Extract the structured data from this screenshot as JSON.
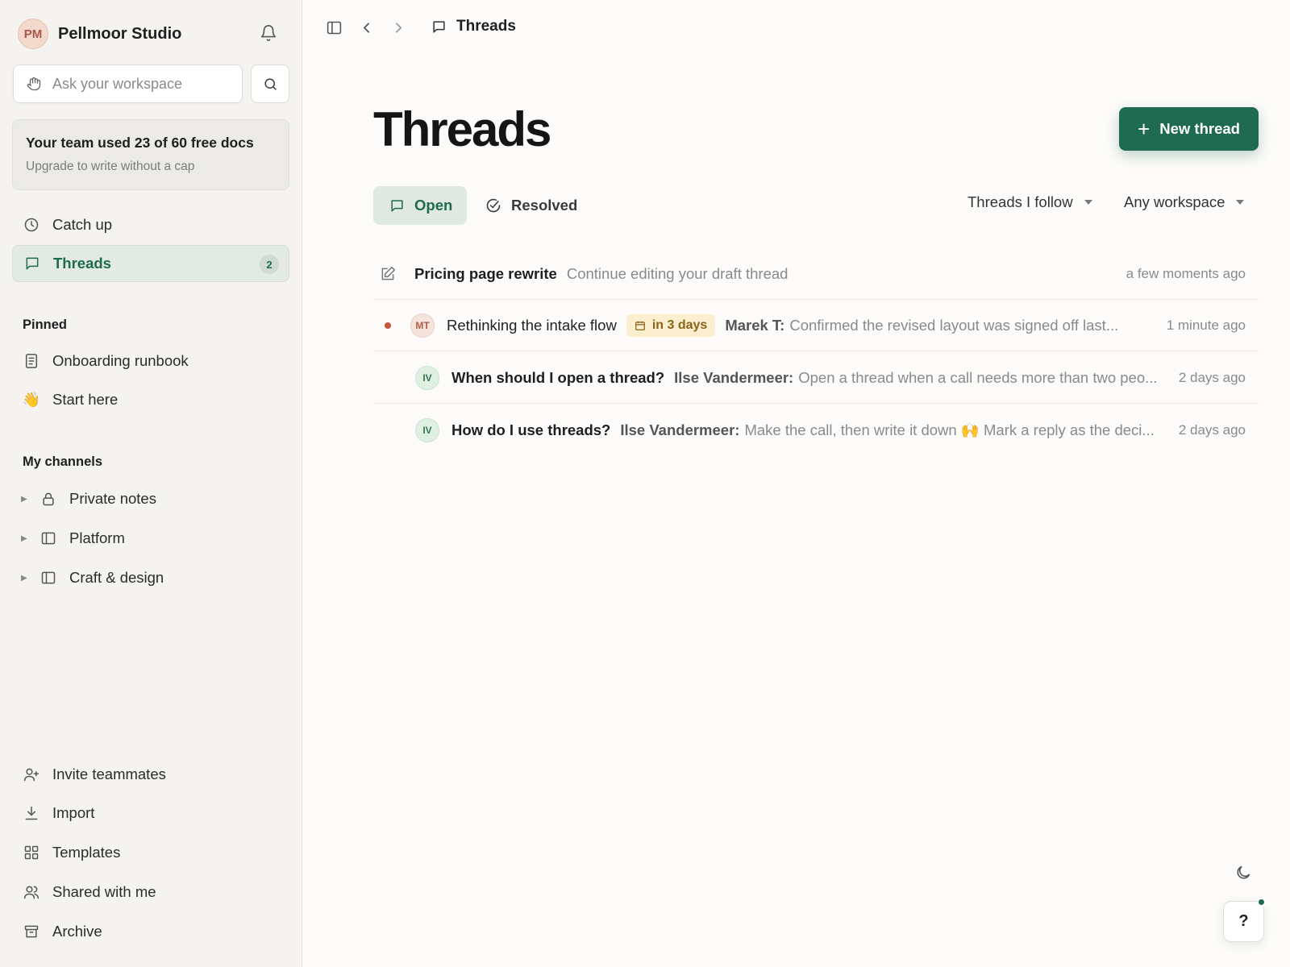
{
  "workspace": {
    "initials": "PM",
    "name": "Pellmoor Studio"
  },
  "search": {
    "placeholder": "Ask your workspace"
  },
  "usage": {
    "title": "Your team used 23 of 60 free docs",
    "subtitle": "Upgrade to write without a cap"
  },
  "nav": {
    "catch_up": "Catch up",
    "threads": "Threads",
    "threads_count": "2"
  },
  "pinned": {
    "label": "Pinned",
    "items": [
      {
        "label": "Onboarding runbook",
        "icon": "document-icon"
      },
      {
        "label": "Start here",
        "icon": "wave-emoji",
        "emoji": "👋"
      }
    ]
  },
  "channels": {
    "label": "My channels",
    "items": [
      {
        "label": "Private notes",
        "icon": "lock-icon"
      },
      {
        "label": "Platform",
        "icon": "panel-icon"
      },
      {
        "label": "Craft & design",
        "icon": "panel-icon"
      }
    ]
  },
  "footer_nav": [
    {
      "label": "Invite teammates",
      "icon": "user-plus-icon"
    },
    {
      "label": "Import",
      "icon": "download-icon"
    },
    {
      "label": "Templates",
      "icon": "grid-icon"
    },
    {
      "label": "Shared with me",
      "icon": "users-icon"
    },
    {
      "label": "Archive",
      "icon": "archive-icon"
    }
  ],
  "breadcrumb": {
    "label": "Threads"
  },
  "page": {
    "title": "Threads",
    "new_thread_label": "New thread",
    "tabs": {
      "open": "Open",
      "resolved": "Resolved"
    },
    "filters": {
      "follow": "Threads I follow",
      "workspace": "Any workspace"
    }
  },
  "threads": [
    {
      "title": "Pricing page rewrite",
      "preview": "Continue editing your draft thread",
      "time": "a few moments ago"
    },
    {
      "initials": "MT",
      "title": "Rethinking the intake flow",
      "due": "in 3 days",
      "author": "Marek T:",
      "preview": "Confirmed the revised layout was signed off last...",
      "time": "1 minute ago"
    },
    {
      "initials": "IV",
      "title": "When should I open a thread?",
      "author": "Ilse Vandermeer:",
      "preview": "Open a thread when a call needs more than two peo...",
      "time": "2 days ago"
    },
    {
      "initials": "IV",
      "title": "How do I use threads?",
      "author": "Ilse Vandermeer:",
      "preview": "Make the call, then write it down 🙌 Mark a reply as the deci...",
      "time": "2 days ago"
    }
  ],
  "help": {
    "label": "?"
  },
  "colors": {
    "accent": "#1f6b52",
    "unread": "#c8553d",
    "due_bg": "#fbefcf"
  }
}
